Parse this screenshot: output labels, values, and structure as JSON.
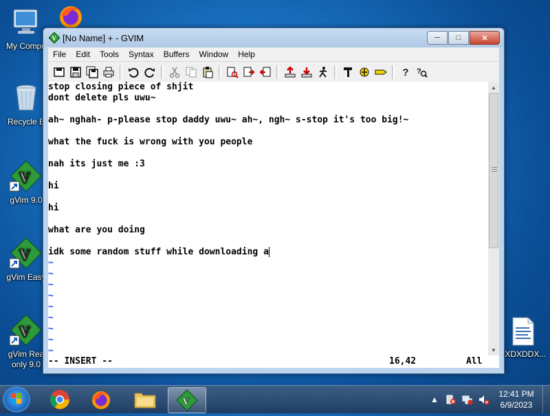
{
  "desktop": {
    "icons": [
      {
        "label": "My Compu",
        "icon": "computer-icon"
      },
      {
        "label": "Recycle B",
        "icon": "recycle-bin-icon"
      },
      {
        "label": "gVim 9.0",
        "icon": "gvim-icon"
      },
      {
        "label": "gVim Easy",
        "icon": "gvim-icon"
      },
      {
        "label": "gVim Rea",
        "label2": "only 9.0",
        "icon": "gvim-icon"
      },
      {
        "label": "DXDXDDX...",
        "icon": "document-icon"
      }
    ],
    "firefox_icon": "firefox-icon"
  },
  "window": {
    "title": "[No Name] + - GVIM",
    "menu": [
      "File",
      "Edit",
      "Tools",
      "Syntax",
      "Buffers",
      "Window",
      "Help"
    ],
    "buttons": {
      "minimize": "minimize-icon",
      "maximize": "maximize-icon",
      "close": "close-icon"
    }
  },
  "editor": {
    "lines": [
      "stop closing piece of shjit",
      "dont delete pls uwu~",
      "",
      "ah~ nghah- p-please stop daddy uwu~ ah~, ngh~ s-stop it's too big!~",
      "",
      "what the fuck is wrong with you people",
      "",
      "nah its just me :3",
      "",
      "hi",
      "",
      "hi",
      "",
      "what are you doing",
      "",
      "idk some random stuff while downloading a"
    ],
    "tilde": "~",
    "tilde_count": 9
  },
  "status": {
    "mode": "-- INSERT --",
    "position": "16,42",
    "scroll": "All"
  },
  "taskbar": {
    "clock_time": "12:41 PM",
    "clock_date": "6/9/2023",
    "apps": [
      "start-orb",
      "chrome-icon",
      "firefox-icon",
      "file-explorer-icon",
      "gvim-icon"
    ]
  },
  "colors": {
    "tilde": "#1f3cff",
    "desktop": "#1a74c4"
  }
}
